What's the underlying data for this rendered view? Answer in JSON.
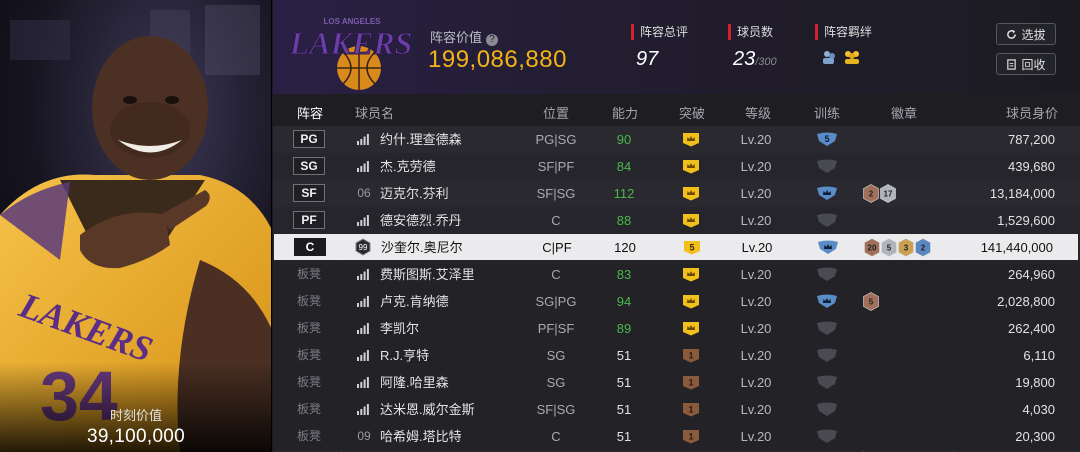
{
  "player_card": {
    "caption": "时刻价值",
    "value": "39,100,000",
    "jersey_text": "LAKERS",
    "jersey_number": "34"
  },
  "header": {
    "logo_text": "LAKERS",
    "logo_subtext": "LOS ANGELES",
    "lineup_value_label": "阵容价值",
    "lineup_value": "199,086,880",
    "overall_label": "阵容总评",
    "overall_value": "97",
    "player_count_label": "球员数",
    "player_count_value": "23",
    "player_count_max": "/300",
    "bond_label": "阵容羁绊",
    "select_button": "选拔",
    "recycle_button": "回收"
  },
  "columns": {
    "lineup": "阵容",
    "name": "球员名",
    "position": "位置",
    "rating": "能力",
    "breakthrough": "突破",
    "level": "等级",
    "training": "训练",
    "badges": "徽章",
    "value": "球员身价"
  },
  "colors": {
    "accent_gold": "#f2b418",
    "green_rating": "#4cb74c",
    "red_marker": "#d0232a"
  },
  "rows": [
    {
      "slot": "PG",
      "starter": true,
      "num": "",
      "icon": "signal-icon",
      "name": "约什.理查德森",
      "position": "PG|SG",
      "rating": "90",
      "green": true,
      "breakthrough": "",
      "bt_type": "crown",
      "level": "Lv.20",
      "training": "5",
      "tr_type": "blue-num",
      "badges": [],
      "value": "787,200"
    },
    {
      "slot": "SG",
      "starter": true,
      "num": "",
      "icon": "signal-icon",
      "name": "杰.克劳德",
      "position": "SF|PF",
      "rating": "84",
      "green": true,
      "breakthrough": "",
      "bt_type": "crown",
      "level": "Lv.20",
      "training": "",
      "tr_type": "gray",
      "badges": [],
      "value": "439,680"
    },
    {
      "slot": "SF",
      "starter": true,
      "num": "06",
      "icon": "",
      "name": "迈克尔.芬利",
      "position": "SF|SG",
      "rating": "112",
      "green": true,
      "breakthrough": "",
      "bt_type": "crown",
      "level": "Lv.20",
      "training": "",
      "tr_type": "blue-crown",
      "badges": [
        {
          "t": "2",
          "c": "bronze"
        },
        {
          "t": "17",
          "c": "silver"
        }
      ],
      "value": "13,184,000"
    },
    {
      "slot": "PF",
      "starter": true,
      "num": "",
      "icon": "signal-icon",
      "name": "德安德烈.乔丹",
      "position": "C",
      "rating": "88",
      "green": true,
      "breakthrough": "",
      "bt_type": "crown",
      "level": "Lv.20",
      "training": "",
      "tr_type": "gray",
      "badges": [],
      "value": "1,529,600"
    },
    {
      "slot": "C",
      "starter": true,
      "selected": true,
      "num": "99",
      "icon": "",
      "name": "沙奎尔.奥尼尔",
      "position": "C|PF",
      "rating": "120",
      "green": false,
      "breakthrough": "5",
      "bt_type": "num",
      "level": "Lv.20",
      "training": "",
      "tr_type": "blue-crown",
      "badges": [
        {
          "t": "20",
          "c": "bronze"
        },
        {
          "t": "5",
          "c": "silver"
        },
        {
          "t": "3",
          "c": "gold"
        },
        {
          "t": "2",
          "c": "blue"
        }
      ],
      "value": "141,440,000"
    },
    {
      "slot": "板凳",
      "starter": false,
      "num": "",
      "icon": "signal-icon",
      "name": "费斯图斯.艾泽里",
      "position": "C",
      "rating": "83",
      "green": true,
      "breakthrough": "",
      "bt_type": "crown",
      "level": "Lv.20",
      "training": "",
      "tr_type": "gray",
      "badges": [],
      "value": "264,960"
    },
    {
      "slot": "板凳",
      "starter": false,
      "num": "",
      "icon": "signal-icon",
      "name": "卢克.肯纳德",
      "position": "SG|PG",
      "rating": "94",
      "green": true,
      "breakthrough": "",
      "bt_type": "crown",
      "level": "Lv.20",
      "training": "",
      "tr_type": "blue-crown",
      "badges": [
        {
          "t": "5",
          "c": "bronze"
        }
      ],
      "value": "2,028,800"
    },
    {
      "slot": "板凳",
      "starter": false,
      "num": "",
      "icon": "signal-icon",
      "name": "李凯尔",
      "position": "PF|SF",
      "rating": "89",
      "green": true,
      "breakthrough": "",
      "bt_type": "crown",
      "level": "Lv.20",
      "training": "",
      "tr_type": "gray",
      "badges": [],
      "value": "262,400"
    },
    {
      "slot": "板凳",
      "starter": false,
      "num": "",
      "icon": "signal-icon",
      "name": "R.J.亨特",
      "position": "SG",
      "rating": "51",
      "green": false,
      "breakthrough": "1",
      "bt_type": "brown",
      "level": "Lv.20",
      "training": "",
      "tr_type": "gray",
      "badges": [],
      "value": "6,110"
    },
    {
      "slot": "板凳",
      "starter": false,
      "num": "",
      "icon": "signal-icon",
      "name": "阿隆.哈里森",
      "position": "SG",
      "rating": "51",
      "green": false,
      "breakthrough": "1",
      "bt_type": "brown",
      "level": "Lv.20",
      "training": "",
      "tr_type": "gray",
      "badges": [],
      "value": "19,800"
    },
    {
      "slot": "板凳",
      "starter": false,
      "num": "",
      "icon": "signal-icon",
      "name": "达米恩.威尔金斯",
      "position": "SF|SG",
      "rating": "51",
      "green": false,
      "breakthrough": "1",
      "bt_type": "brown",
      "level": "Lv.20",
      "training": "",
      "tr_type": "gray",
      "badges": [],
      "value": "4,030"
    },
    {
      "slot": "板凳",
      "starter": false,
      "num": "09",
      "icon": "",
      "name": "哈希姆.塔比特",
      "position": "C",
      "rating": "51",
      "green": false,
      "breakthrough": "1",
      "bt_type": "brown",
      "level": "Lv.20",
      "training": "",
      "tr_type": "gray",
      "badges": [],
      "value": "20,300"
    }
  ]
}
